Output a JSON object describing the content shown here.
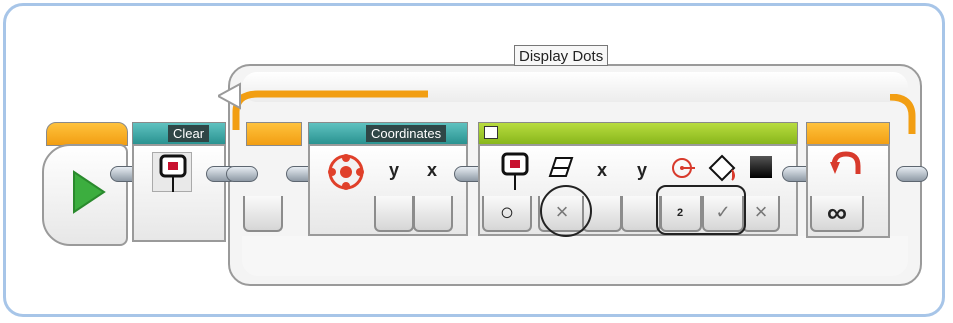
{
  "loop": {
    "label": "Display Dots",
    "count_symbol": "∞"
  },
  "clear_block": {
    "label": "Clear"
  },
  "coordinates_block": {
    "label": "Coordinates",
    "outputs": [
      "y",
      "x"
    ]
  },
  "display_block": {
    "inputs": [
      "x",
      "y"
    ],
    "size_value": "2",
    "mode_symbol": "○",
    "clear_symbol": "×",
    "fill_symbol": "✓",
    "color_symbol": "×"
  },
  "colors": {
    "wire": "#f4c430",
    "loop_orange": "#f29e12",
    "start_green": "#3cae3f",
    "teal": "#27908e",
    "lime": "#86b51a",
    "frame": "#a7c5e8"
  },
  "icons": [
    "play-icon",
    "ev3-brick-display-icon",
    "variable-sphere-icon",
    "eraser-icon",
    "radius-icon",
    "fill-bucket-icon",
    "color-swatch-icon",
    "loop-arrow-icon",
    "infinity-icon"
  ]
}
